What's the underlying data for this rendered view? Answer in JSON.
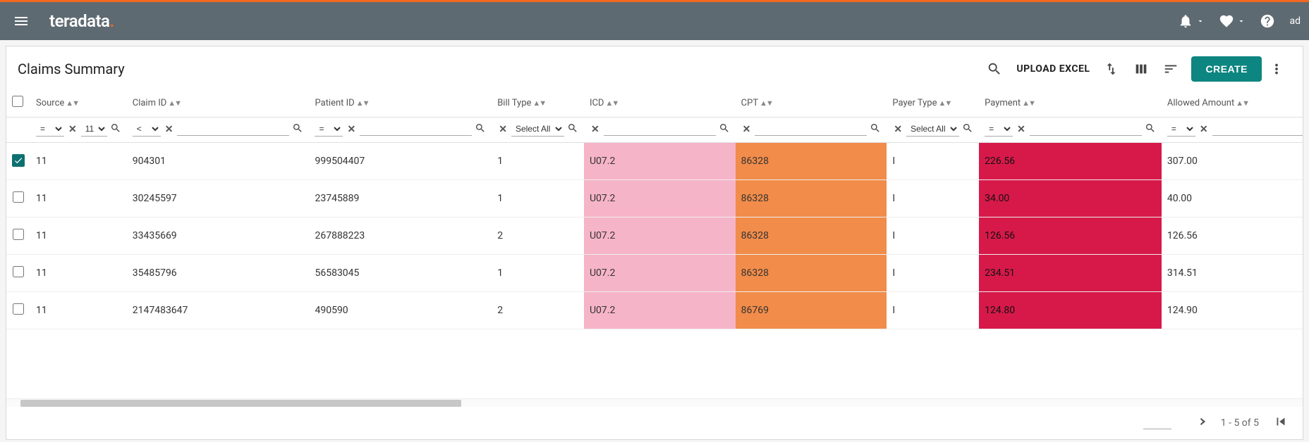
{
  "header": {
    "logo_text": "teradata",
    "logo_dot": ".",
    "user_text": "ad"
  },
  "page": {
    "title": "Claims Summary",
    "upload_label": "UPLOAD EXCEL",
    "create_label": "CREATE"
  },
  "columns": [
    {
      "key": "source",
      "label": "Source"
    },
    {
      "key": "claim_id",
      "label": "Claim ID"
    },
    {
      "key": "patient_id",
      "label": "Patient ID"
    },
    {
      "key": "bill_type",
      "label": "Bill Type"
    },
    {
      "key": "icd",
      "label": "ICD"
    },
    {
      "key": "cpt",
      "label": "CPT"
    },
    {
      "key": "payer_type",
      "label": "Payer Type"
    },
    {
      "key": "payment",
      "label": "Payment"
    },
    {
      "key": "allowed",
      "label": "Allowed Amount"
    }
  ],
  "filters": {
    "source": {
      "op": "=",
      "value": "11"
    },
    "claim_id": {
      "op": "<",
      "value": ""
    },
    "patient_id": {
      "op": "=",
      "value": ""
    },
    "bill_type": {
      "select": "Select All"
    },
    "icd": {
      "value": ""
    },
    "cpt": {
      "value": ""
    },
    "payer_type": {
      "select": "Select All"
    },
    "payment": {
      "op": "=",
      "value": ""
    },
    "allowed": {
      "op": "=",
      "value": ""
    }
  },
  "rows": [
    {
      "checked": true,
      "source": "11",
      "claim_id": "904301",
      "patient_id": "999504407",
      "bill_type": "1",
      "icd": "U07.2",
      "cpt": "86328",
      "payer_type": "I",
      "payment": "226.56",
      "allowed": "307.00"
    },
    {
      "checked": false,
      "source": "11",
      "claim_id": "30245597",
      "patient_id": "23745889",
      "bill_type": "1",
      "icd": "U07.2",
      "cpt": "86328",
      "payer_type": "I",
      "payment": "34.00",
      "allowed": "40.00"
    },
    {
      "checked": false,
      "source": "11",
      "claim_id": "33435669",
      "patient_id": "267888223",
      "bill_type": "2",
      "icd": "U07.2",
      "cpt": "86328",
      "payer_type": "I",
      "payment": "126.56",
      "allowed": "126.56"
    },
    {
      "checked": false,
      "source": "11",
      "claim_id": "35485796",
      "patient_id": "56583045",
      "bill_type": "1",
      "icd": "U07.2",
      "cpt": "86328",
      "payer_type": "I",
      "payment": "234.51",
      "allowed": "314.51"
    },
    {
      "checked": false,
      "source": "11",
      "claim_id": "2147483647",
      "patient_id": "490590",
      "bill_type": "2",
      "icd": "U07.2",
      "cpt": "86769",
      "payer_type": "I",
      "payment": "124.80",
      "allowed": "124.90"
    }
  ],
  "pager": {
    "range": "1 - 5 of 5"
  }
}
